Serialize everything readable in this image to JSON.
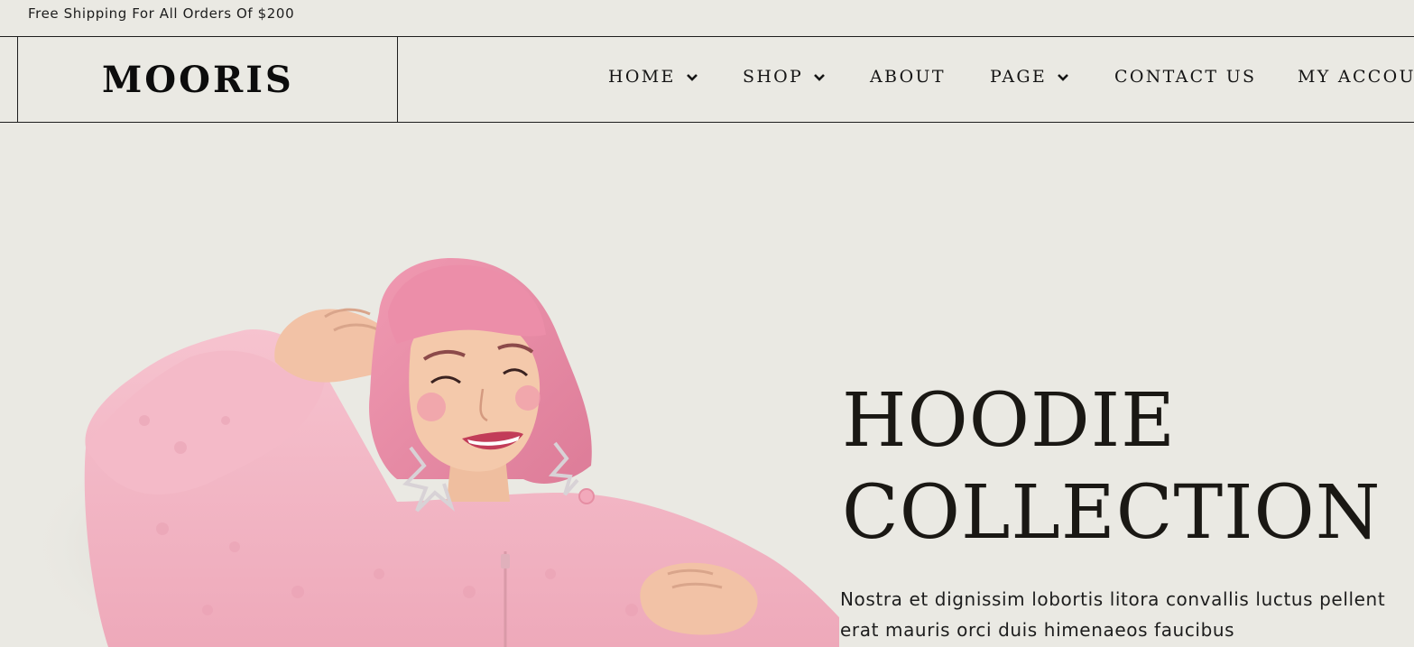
{
  "topbar": {
    "shipping_text": "Free Shipping For All Orders Of $200"
  },
  "header": {
    "logo": "MOORIS",
    "nav": [
      {
        "label": "HOME",
        "has_dropdown": true
      },
      {
        "label": "SHOP",
        "has_dropdown": true
      },
      {
        "label": "ABOUT",
        "has_dropdown": false
      },
      {
        "label": "PAGE",
        "has_dropdown": true
      },
      {
        "label": "CONTACT US",
        "has_dropdown": false
      },
      {
        "label": "MY ACCOU",
        "has_dropdown": false
      }
    ]
  },
  "hero": {
    "title_line1": "HOODIE",
    "title_line2": "COLLECTION",
    "description_line1": "Nostra et dignissim lobortis litora convallis luctus pellent",
    "description_line2": "erat mauris orci duis himenaeos faucibus",
    "image_subject": "smiling woman with pink bob hair in pink fluffy hoodie"
  },
  "colors": {
    "background": "#eae9e3",
    "text": "#111111",
    "border": "#1e1e1e",
    "hoodie_pink": "#f2b3c3",
    "hair_pink": "#e98aa6"
  }
}
